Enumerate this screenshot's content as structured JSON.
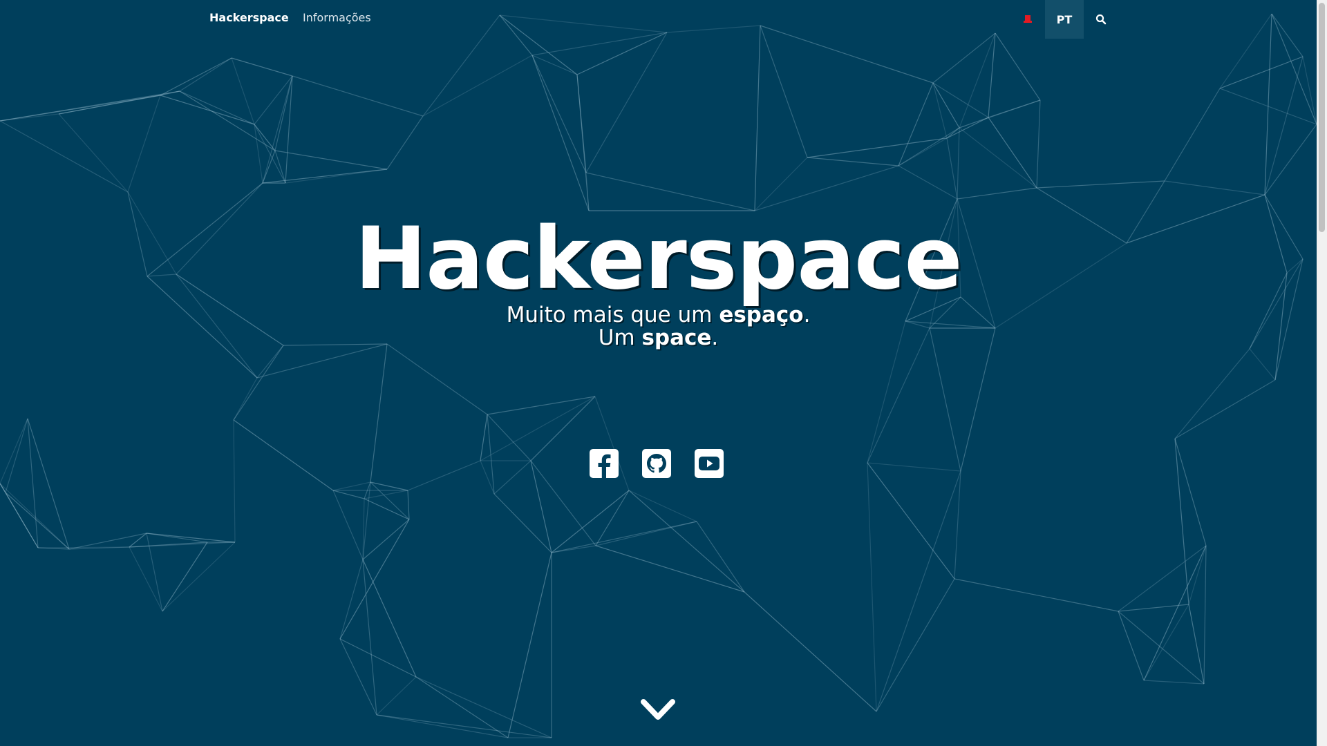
{
  "nav": {
    "brand": "Hackerspace",
    "links": [
      {
        "label": "Informações"
      }
    ],
    "language": "PT",
    "status_icon": "red-alert-icon",
    "search_icon": "search-icon"
  },
  "hero": {
    "title": "Hackerspace",
    "tagline_line1_prefix": "Muito mais que um ",
    "tagline_line1_bold": "espaço",
    "tagline_line1_suffix": ".",
    "tagline_line2_prefix": "Um ",
    "tagline_line2_bold": "space",
    "tagline_line2_suffix": "."
  },
  "social": [
    {
      "name": "facebook-icon"
    },
    {
      "name": "github-icon"
    },
    {
      "name": "youtube-icon"
    }
  ],
  "colors": {
    "background": "#003f5c",
    "active_lang_bg": "#124f6a",
    "alert": "#e31b23"
  }
}
